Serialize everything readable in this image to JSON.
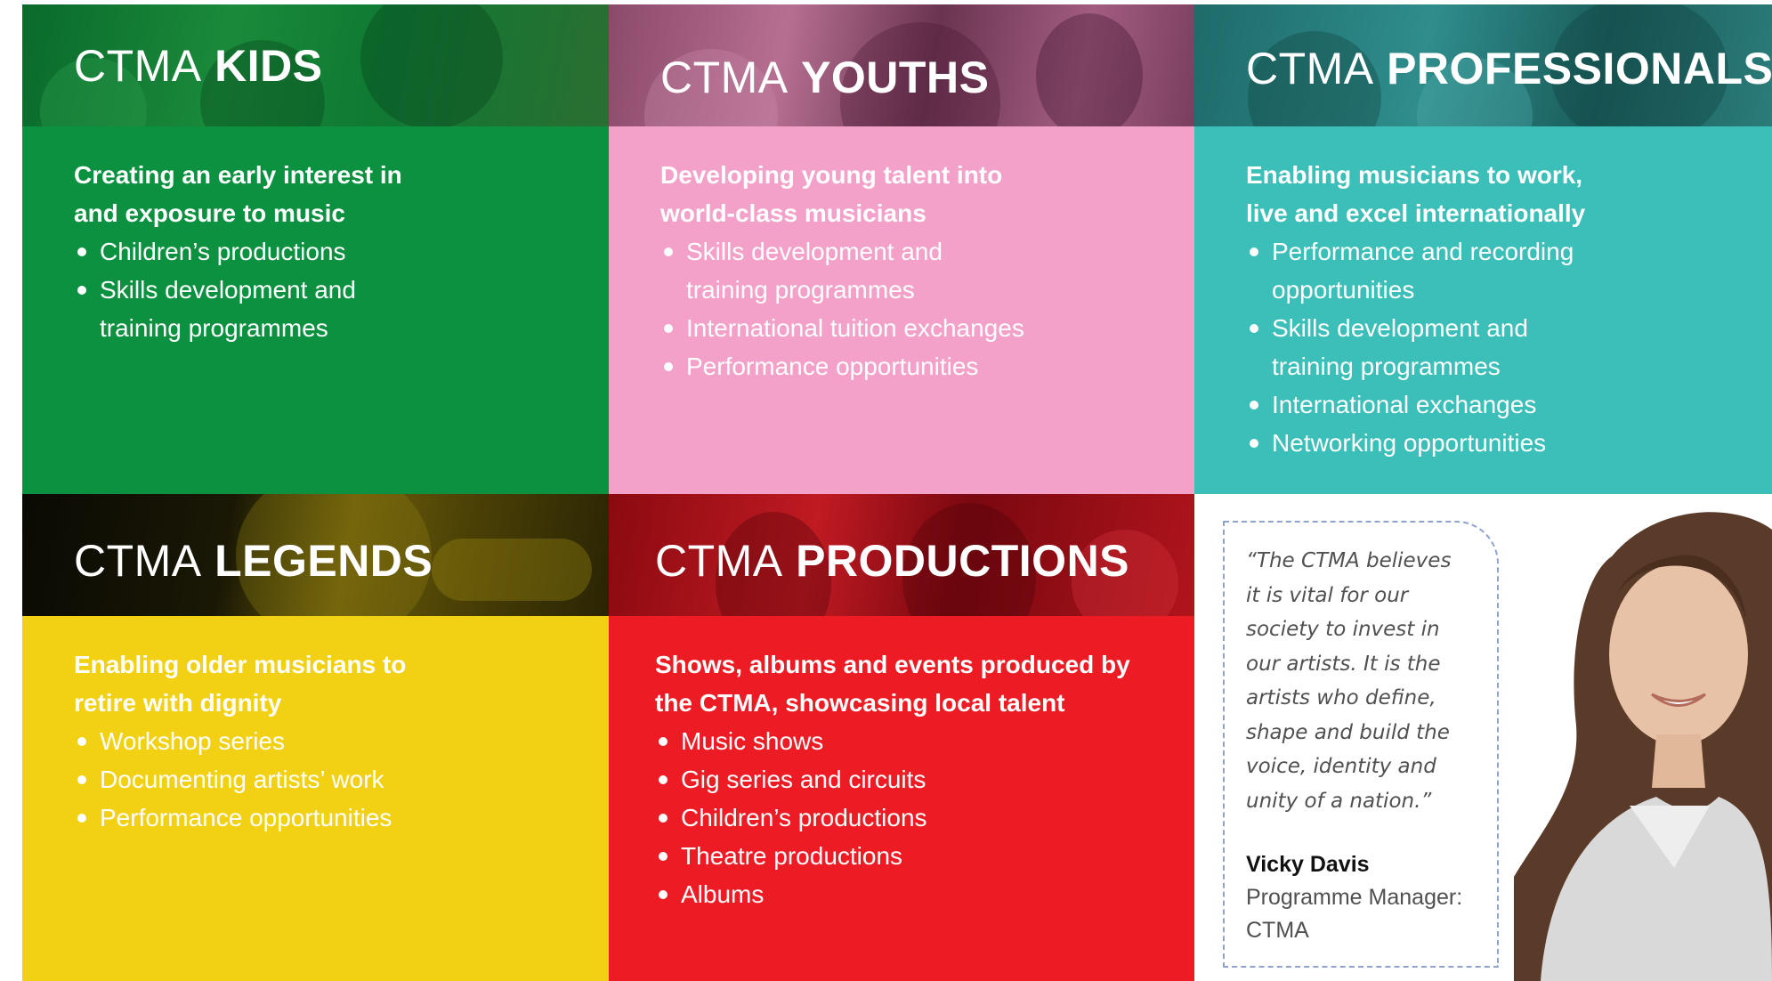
{
  "colors": {
    "kids": "#0c9140",
    "youths": "#f4a1c9",
    "professionals": "#3bbfb8",
    "legends": "#f2d013",
    "productions": "#ed1c24",
    "quote_border": "#8ea4cf"
  },
  "panels": {
    "kids": {
      "title_prefix": "CTMA",
      "title_main": "KIDS",
      "lead": "Creating an early interest in and exposure to music",
      "items": [
        "Children’s productions",
        "Skills development and training programmes"
      ]
    },
    "youths": {
      "title_prefix": "CTMA",
      "title_main": "YOUTHS",
      "lead": "Developing young talent into world-class musicians",
      "items": [
        "Skills development and training programmes",
        "International tuition exchanges",
        "Performance opportunities"
      ]
    },
    "professionals": {
      "title_prefix": "CTMA",
      "title_main": "PROFESSIONALS",
      "lead": "Enabling musicians to work, live and excel internationally",
      "items": [
        "Performance and recording opportunities",
        "Skills development and training programmes",
        "International exchanges",
        "Networking opportunities"
      ]
    },
    "legends": {
      "title_prefix": "CTMA",
      "title_main": "LEGENDS",
      "lead": "Enabling older musicians to retire with dignity",
      "items": [
        "Workshop series",
        "Documenting artists’ work",
        "Performance opportunities"
      ]
    },
    "productions": {
      "title_prefix": "CTMA",
      "title_main": "PRODUCTIONS",
      "lead": "Shows, albums and events produced by the CTMA, showcasing local talent",
      "items": [
        "Music shows",
        "Gig series and circuits",
        "Children’s productions",
        "Theatre productions",
        "Albums"
      ]
    }
  },
  "quote": {
    "text": "“The CTMA believes\nit is vital for our\nsociety to invest in\nour artists. It is the\nartists who define,\nshape and build the\nvoice, identity and\nunity of a nation.”",
    "name": "Vicky Davis",
    "role": "Programme Manager:\nCTMA"
  }
}
